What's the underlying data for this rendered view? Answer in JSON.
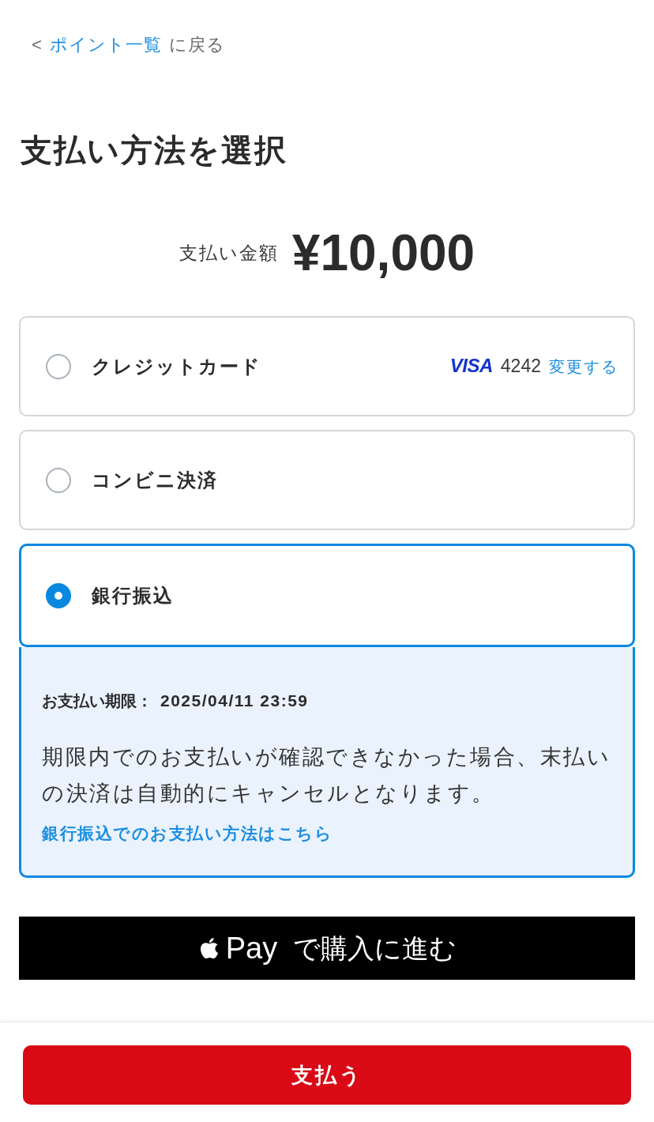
{
  "back_link": {
    "arrow": "<",
    "link": "ポイント一覧",
    "suffix": "に戻る"
  },
  "title": "支払い方法を選択",
  "amount": {
    "label": "支払い金額",
    "value": "¥10,000"
  },
  "payment_methods": [
    {
      "kind": "card",
      "label": "クレジットカード",
      "selected": false,
      "brand": "VISA",
      "last4": "4242",
      "change_link": "変更する"
    },
    {
      "kind": "plain",
      "label": "コンビニ決済",
      "selected": false
    },
    {
      "kind": "plain",
      "label": "銀行振込",
      "selected": true,
      "details": {
        "deadline_label": "お支払い期限：",
        "deadline": "2025/04/11 23:59",
        "notice": "期限内でのお支払いが確認できなかった場合、末払いの決済は自動的にキャンセルとなります。",
        "help_link": "銀行振込でのお支払い方法はこちら"
      }
    }
  ],
  "apple_pay_button": {
    "brand": "Pay",
    "label": "で購入に進む"
  },
  "pay_button": "支払う"
}
